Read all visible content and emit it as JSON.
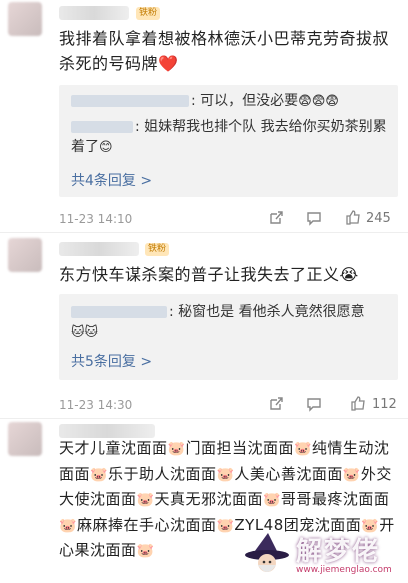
{
  "comments": [
    {
      "badge": "铁粉",
      "text": "我排着队拿着想被格林德沃小巴蒂克劳奇拔叔杀死的号码牌",
      "emoji": "❤️",
      "replies": [
        {
          "text": ": 可以，但没必要",
          "emoji": "😨😨😨"
        },
        {
          "text": ": 姐妹帮我也排个队 我去给你买奶茶别累着了",
          "emoji": "😊"
        }
      ],
      "more_label": "共4条回复 >",
      "time": "11-23 14:10",
      "likes": "245"
    },
    {
      "badge": "铁粉",
      "text": "东方快车谋杀案的普子让我失去了正义",
      "emoji": "😭",
      "replies": [
        {
          "text": ": 秘窗也是 看他杀人竟然很愿意",
          "emoji": "🐱🐱"
        }
      ],
      "more_label": "共5条回复 >",
      "time": "11-23 14:30",
      "likes": "112"
    },
    {
      "badge": "",
      "lines": [
        "天才儿童沈面面",
        "门面担当沈面面",
        "纯情生动沈面面",
        "乐于助人沈面面",
        "人美心善沈面面",
        "外交大使沈面面",
        "天真无邪沈面面",
        "哥哥最疼沈面面",
        "麻麻捧在手心沈面面",
        "ZYL48团宠沈面面",
        "开心果沈面面"
      ]
    }
  ],
  "watermark": {
    "brand": "解梦佬",
    "url": "www.jiemenglao.com"
  },
  "colors": {
    "link": "#4a6fa1",
    "badge_bg": "#ffe6b8",
    "reply_bg": "#f2f2f2"
  }
}
